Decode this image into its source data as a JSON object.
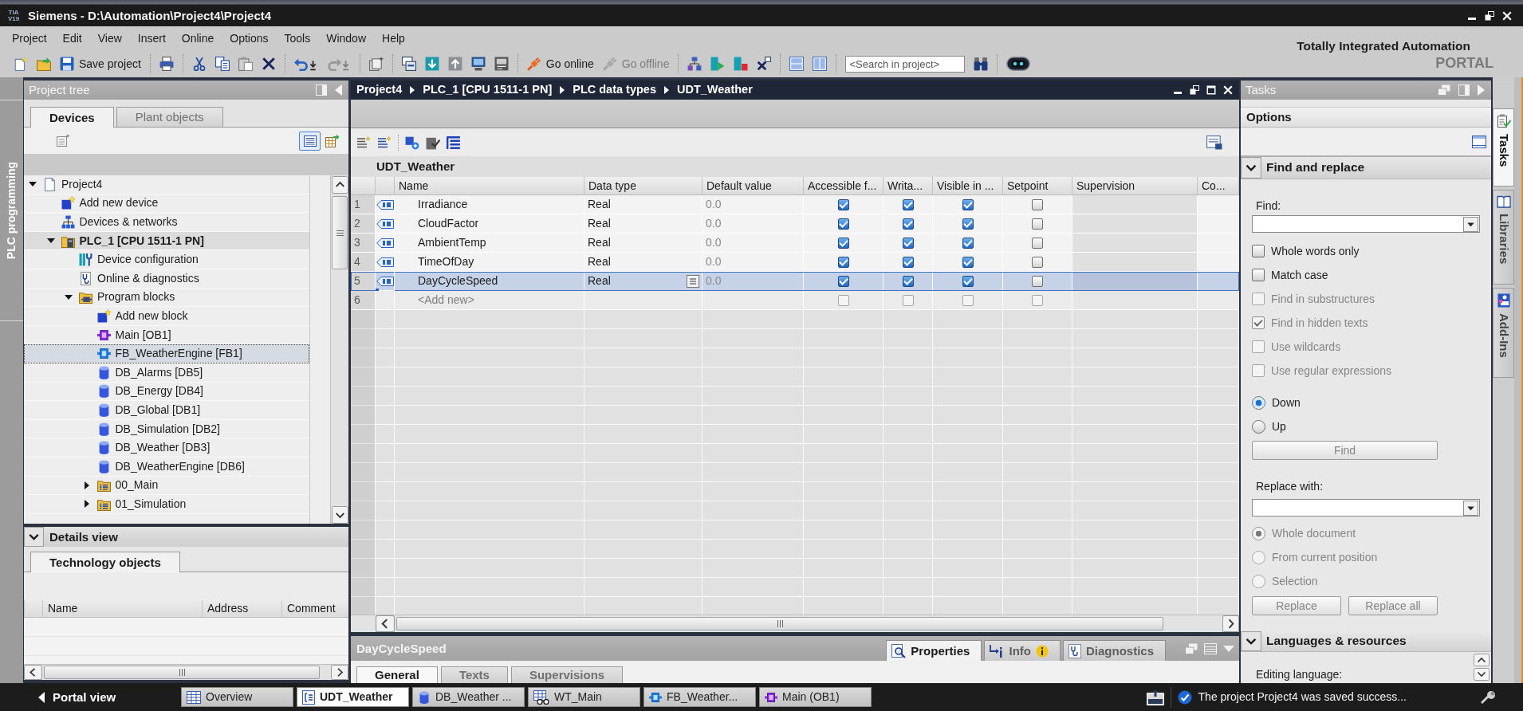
{
  "window": {
    "logo": [
      "TIA",
      "V19"
    ],
    "title": "Siemens - D:\\Automation\\Project4\\Project4"
  },
  "menu": [
    "Project",
    "Edit",
    "View",
    "Insert",
    "Online",
    "Options",
    "Tools",
    "Window",
    "Help"
  ],
  "toolbar": {
    "save": {
      "label": "Save project"
    },
    "undo": {
      "disabled": false
    },
    "redo": {
      "disabled": true
    },
    "go_online": {
      "label": "Go online",
      "disabled": false
    },
    "go_offline": {
      "label": "Go offline",
      "disabled": true
    },
    "search": {
      "placeholder": "<Search in project>"
    }
  },
  "brand": {
    "line_1": "Totally Integrated Automation",
    "line_2": "PORTAL"
  },
  "side_strip": {
    "label": "PLC programming"
  },
  "project_tree": {
    "title": "Project tree",
    "tabs": [
      {
        "label": "Devices",
        "selected": true
      },
      {
        "label": "Plant objects",
        "selected": false
      }
    ],
    "list_view": {
      "on": true
    },
    "items": [
      {
        "label": "Project4",
        "kind": "project",
        "expanded": true,
        "selected": false,
        "current": false,
        "children": [
          {
            "label": "Add new device",
            "kind": "add-device",
            "selected": false,
            "current": false
          },
          {
            "label": "Devices & networks",
            "kind": "network",
            "selected": false,
            "current": false
          },
          {
            "label": "PLC_1 [CPU 1511-1 PN]",
            "kind": "plc",
            "expanded": true,
            "selected": false,
            "current": true,
            "children": [
              {
                "label": "Device configuration",
                "kind": "device-config",
                "selected": false,
                "current": false
              },
              {
                "label": "Online & diagnostics",
                "kind": "online-diag",
                "selected": false,
                "current": false
              },
              {
                "label": "Program blocks",
                "kind": "folder",
                "expanded": true,
                "selected": false,
                "current": false,
                "children": [
                  {
                    "label": "Add new block",
                    "kind": "add-block",
                    "selected": false,
                    "current": false
                  },
                  {
                    "label": "Main [OB1]",
                    "kind": "ob",
                    "selected": false,
                    "current": false
                  },
                  {
                    "label": "FB_WeatherEngine [FB1]",
                    "kind": "fb",
                    "selected": true,
                    "current": false
                  },
                  {
                    "label": "DB_Alarms [DB5]",
                    "kind": "db",
                    "selected": false,
                    "current": false
                  },
                  {
                    "label": "DB_Energy [DB4]",
                    "kind": "db",
                    "selected": false,
                    "current": false
                  },
                  {
                    "label": "DB_Global [DB1]",
                    "kind": "db",
                    "selected": false,
                    "current": false
                  },
                  {
                    "label": "DB_Simulation [DB2]",
                    "kind": "db",
                    "selected": false,
                    "current": false
                  },
                  {
                    "label": "DB_Weather [DB3]",
                    "kind": "db",
                    "selected": false,
                    "current": false
                  },
                  {
                    "label": "DB_WeatherEngine [DB6]",
                    "kind": "db",
                    "selected": false,
                    "current": false
                  },
                  {
                    "label": "00_Main",
                    "kind": "group",
                    "expanded": false,
                    "selected": false,
                    "current": false
                  },
                  {
                    "label": "01_Simulation",
                    "kind": "group",
                    "expanded": false,
                    "selected": false,
                    "current": false
                  }
                ]
              }
            ]
          }
        ]
      }
    ]
  },
  "details_view": {
    "title": "Details view",
    "expanded": true,
    "tabs": [
      {
        "label": "Technology objects",
        "selected": true
      }
    ],
    "columns": [
      "Name",
      "Address",
      "Comment"
    ]
  },
  "editor": {
    "breadcrumb": [
      "Project4",
      "PLC_1 [CPU 1511-1 PN]",
      "PLC data types",
      "UDT_Weather"
    ],
    "title": "UDT_Weather",
    "columns": [
      "Name",
      "Data type",
      "Default value",
      "Accessible f...",
      "Writa...",
      "Visible in ...",
      "Setpoint",
      "Supervision",
      "Co..."
    ],
    "rows": [
      {
        "number": "1",
        "kind": "member",
        "name": "Irradiance",
        "data_type": "Real",
        "default_value": "0.0",
        "accessible": true,
        "writable": true,
        "visible": true,
        "setpoint": false,
        "selected": false
      },
      {
        "number": "2",
        "kind": "member",
        "name": "CloudFactor",
        "data_type": "Real",
        "default_value": "0.0",
        "accessible": true,
        "writable": true,
        "visible": true,
        "setpoint": false,
        "selected": false
      },
      {
        "number": "3",
        "kind": "member",
        "name": "AmbientTemp",
        "data_type": "Real",
        "default_value": "0.0",
        "accessible": true,
        "writable": true,
        "visible": true,
        "setpoint": false,
        "selected": false
      },
      {
        "number": "4",
        "kind": "member",
        "name": "TimeOfDay",
        "data_type": "Real",
        "default_value": "0.0",
        "accessible": true,
        "writable": true,
        "visible": true,
        "setpoint": false,
        "selected": false
      },
      {
        "number": "5",
        "kind": "member",
        "name": "DayCycleSpeed",
        "data_type": "Real",
        "default_value": "0.0",
        "accessible": true,
        "writable": true,
        "visible": true,
        "setpoint": false,
        "selected": true
      },
      {
        "number": "6",
        "kind": "add-new",
        "name": "<Add new>",
        "accessible": false,
        "writable": false,
        "visible": false,
        "setpoint": false,
        "selected": false
      }
    ]
  },
  "inspector": {
    "object": "DayCycleSpeed",
    "tabs": [
      {
        "label": "Properties",
        "kind": "properties",
        "selected": true,
        "alert": false
      },
      {
        "label": "Info",
        "kind": "info",
        "selected": false,
        "alert": true
      },
      {
        "label": "Diagnostics",
        "kind": "diagnostics",
        "selected": false,
        "alert": false
      }
    ],
    "subtabs": [
      {
        "label": "General",
        "selected": true
      },
      {
        "label": "Texts",
        "selected": false
      },
      {
        "label": "Supervisions",
        "selected": false
      }
    ]
  },
  "tasks": {
    "title": "Tasks",
    "section": "Options",
    "find_replace": {
      "title": "Find and replace",
      "expanded": true,
      "find_label": "Find:",
      "options": [
        {
          "label": "Whole words only",
          "checked": false,
          "disabled": false
        },
        {
          "label": "Match case",
          "checked": false,
          "disabled": false
        },
        {
          "label": "Find in substructures",
          "checked": false,
          "disabled": true
        },
        {
          "label": "Find in hidden texts",
          "checked": true,
          "disabled": true
        },
        {
          "label": "Use wildcards",
          "checked": false,
          "disabled": true
        },
        {
          "label": "Use regular expressions",
          "checked": false,
          "disabled": true
        }
      ],
      "direction": [
        {
          "label": "Down",
          "selected": true,
          "disabled": false
        },
        {
          "label": "Up",
          "selected": false,
          "disabled": false
        }
      ],
      "find_button": {
        "label": "Find",
        "disabled": true
      },
      "replace_label": "Replace with:",
      "scope": [
        {
          "label": "Whole document",
          "selected": true,
          "disabled": true
        },
        {
          "label": "From current position",
          "selected": false,
          "disabled": true
        },
        {
          "label": "Selection",
          "selected": false,
          "disabled": true
        }
      ],
      "buttons": [
        {
          "label": "Replace",
          "disabled": true
        },
        {
          "label": "Replace all",
          "disabled": true
        }
      ]
    },
    "languages": {
      "title": "Languages & resources",
      "expanded": true,
      "editing_label": "Editing language:"
    }
  },
  "side_tabs": [
    {
      "label": "Tasks",
      "kind": "tasks",
      "selected": true
    },
    {
      "label": "Libraries",
      "kind": "libraries",
      "selected": false
    },
    {
      "label": "Add-Ins",
      "kind": "add-ins",
      "selected": false
    }
  ],
  "taskbar": {
    "portal_view": "Portal view",
    "items": [
      {
        "label": "Overview",
        "kind": "overview",
        "selected": false
      },
      {
        "label": "UDT_Weather",
        "kind": "udt",
        "selected": true
      },
      {
        "label": "DB_Weather ...",
        "kind": "db",
        "selected": false
      },
      {
        "label": "WT_Main",
        "kind": "watch",
        "selected": false
      },
      {
        "label": "FB_Weather...",
        "kind": "fb",
        "selected": false
      },
      {
        "label": "Main (OB1)",
        "kind": "ob",
        "selected": false
      }
    ],
    "status": "The project Project4 was saved success..."
  }
}
